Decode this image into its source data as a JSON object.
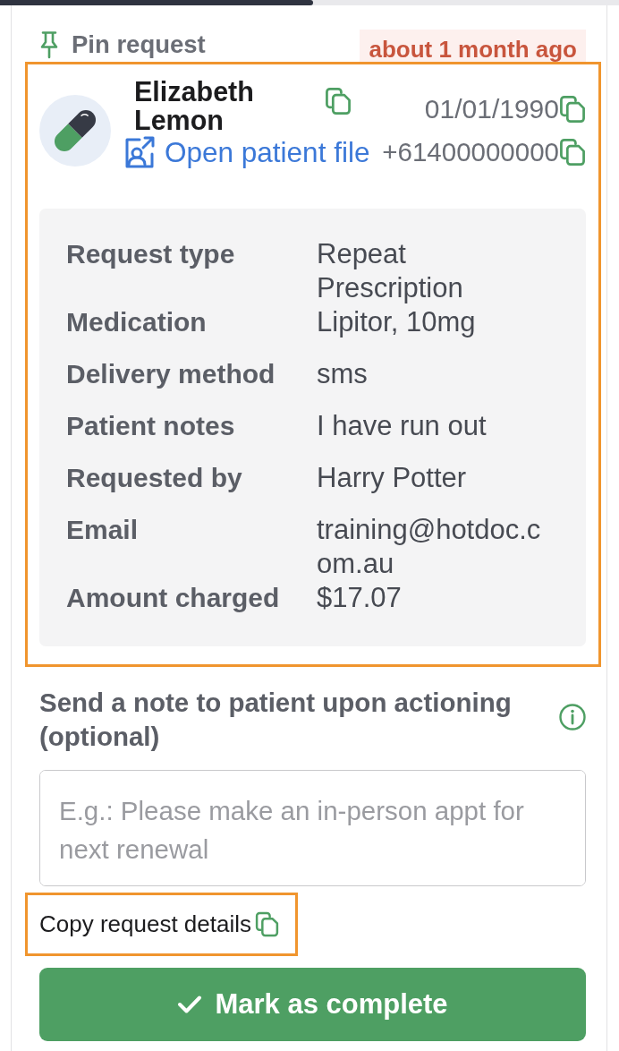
{
  "pin": {
    "label": "Pin request"
  },
  "timestamp": "about 1 month ago",
  "patient": {
    "highlighted": true,
    "name": "Elizabeth Lemon",
    "date_of_birth": "01/01/1990",
    "link": "Open patient file",
    "phone": "+61400000000"
  },
  "details": [
    {
      "label": "Request type",
      "value": "Repeat Prescription"
    },
    {
      "label": "Medication",
      "value": "Lipitor, 10mg"
    },
    {
      "label": "Delivery method",
      "value": "sms"
    },
    {
      "label": "Patient notes",
      "value": "I have run out"
    },
    {
      "label": "Requested by",
      "value": "Harry Potter"
    },
    {
      "label": "Email",
      "value": "training@hotdoc.com.au"
    },
    {
      "label": "Amount charged",
      "value": "$17.07"
    }
  ],
  "note": {
    "heading": "Send a note to patient upon actioning (optional)",
    "placeholder": "E.g.: Please make an in-person appt for next renewal"
  },
  "copy_action": {
    "highlighted": true,
    "label": "Copy request details"
  },
  "complete_button": {
    "label": "Mark as complete"
  }
}
